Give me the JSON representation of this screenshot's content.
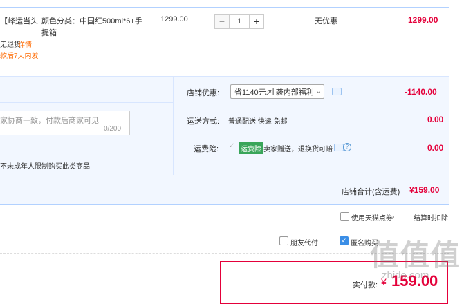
{
  "item": {
    "name_fragment": "【峰运当头...",
    "spec": "颜色分类：中国红500ml*6+手",
    "spec_line2": "提箱",
    "return_note": "无退货",
    "details_link": "详情",
    "ship_note": "款后7天内发",
    "unit_price": "1299.00",
    "quantity": "1",
    "minus": "−",
    "plus": "+",
    "discount_status": "无优惠",
    "subtotal": "1299.00"
  },
  "shop": {
    "discount_label": "店铺优惠:",
    "discount_option": "省1140元:杜袭内部福利",
    "discount_amount": "-1140.00",
    "message_placeholder": "家协商一致，付款后商家可见",
    "message_counter": "0/200",
    "delivery_label": "运送方式:",
    "delivery_value": "普通配送 快递 免邮",
    "delivery_amount": "0.00",
    "insurance_label": "运费险:",
    "insurance_tag": "运费险",
    "insurance_value": "卖家赠送，退换货可赔",
    "insurance_amount": "0.00",
    "age_note": "不未成年人限制购买此类商品",
    "total_label": "店铺合计(含运费)",
    "total_value": "¥159.00"
  },
  "options": {
    "tmall_points": "使用天猫点券:",
    "checkout_deduct": "结算时扣除",
    "friend_pay": "朋友代付",
    "anonymous": "匿名购买"
  },
  "pay": {
    "label": "实付款:",
    "currency": "¥",
    "amount": "159.00"
  },
  "watermark": {
    "main": "值值值",
    "sub": "zhide.com"
  },
  "colors": {
    "price_red": "#e4003a",
    "accent_blue": "#b2d1ff",
    "panel_bg": "#f2f7ff"
  }
}
